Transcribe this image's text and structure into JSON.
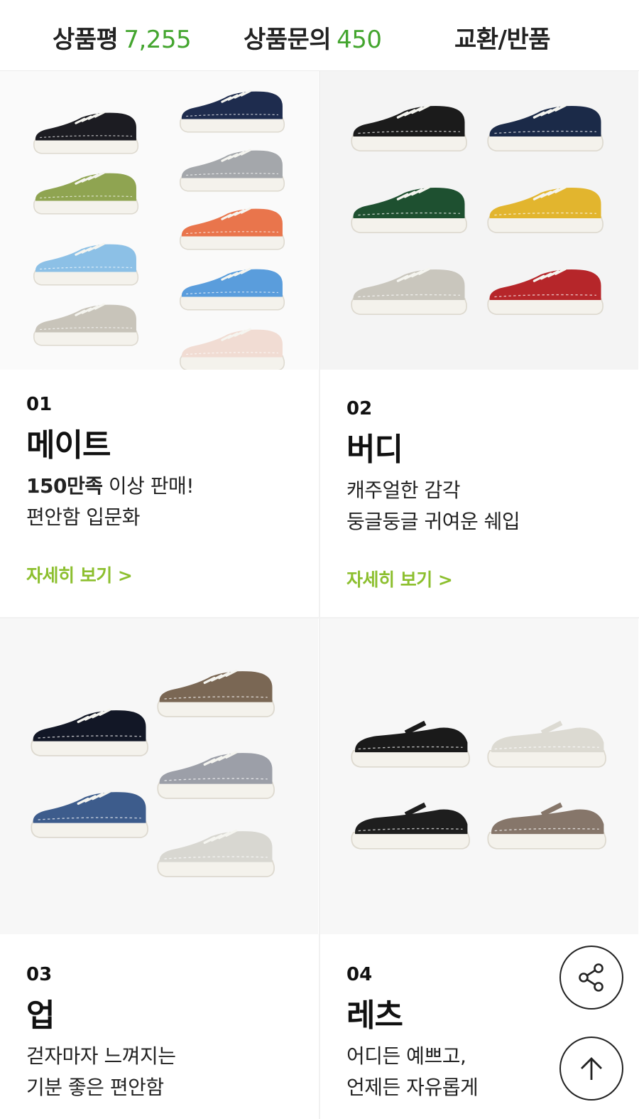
{
  "tabs": {
    "review_label": "상품평",
    "review_count": "7,255",
    "qna_label": "상품문의",
    "qna_count": "450",
    "exchange_label": "교환/반품"
  },
  "products": [
    {
      "number": "01",
      "name": "메이트",
      "desc_bold": "150만족",
      "desc_line1_rest": " 이상 판매!",
      "desc_line2": "편안함 입문화",
      "more_label": "자세히 보기 >"
    },
    {
      "number": "02",
      "name": "버디",
      "desc_line1": "캐주얼한 감각",
      "desc_line2": "둥글둥글 귀여운 쉐입",
      "more_label": "자세히 보기 >"
    },
    {
      "number": "03",
      "name": "업",
      "desc_line1": "걷자마자 느껴지는",
      "desc_line2": "기분 좋은 편안함"
    },
    {
      "number": "04",
      "name": "레츠",
      "desc_line1": "어디든 예쁘고,",
      "desc_line2": "언제든 자유롭게"
    }
  ],
  "colors": {
    "accent_count": "#43a52e",
    "more_link": "#8cbf2e",
    "mate_shoes": [
      "#1c1c22",
      "#1e2c4e",
      "#8fa451",
      "#a4a7ab",
      "#8cc0e6",
      "#e9754c",
      "#c8c4ba",
      "#5a9ddc",
      "#f1dcd3"
    ],
    "buddy_shoes": [
      "#1b1b1b",
      "#1b2a48",
      "#1e5030",
      "#e2b52e",
      "#c9c6bd",
      "#b6262a"
    ],
    "up_shoes": [
      "#7a6754",
      "#121726",
      "#9c9fa8",
      "#3d5c8c",
      "#d8d7d1"
    ],
    "lets_shoes": [
      "#1a1a1a",
      "#dcdad2",
      "#1e1e1e",
      "#86766a"
    ]
  },
  "icons": {
    "share": "share-icon",
    "top": "arrow-up-icon"
  }
}
